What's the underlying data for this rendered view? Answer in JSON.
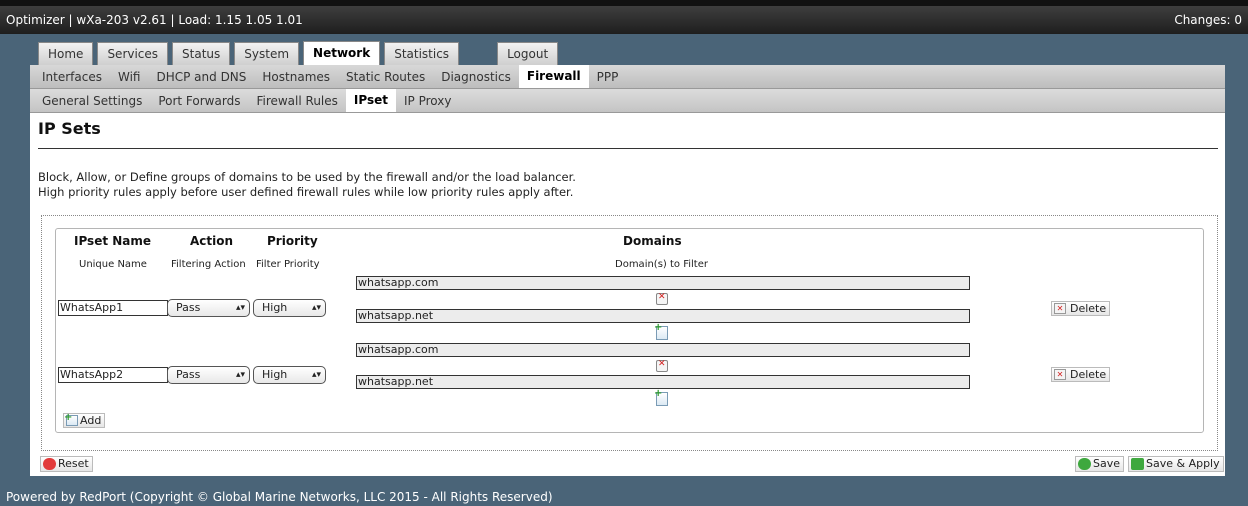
{
  "header": {
    "title": "Optimizer | wXa-203 v2.61 | Load: 1.15 1.05 1.01",
    "changes": "Changes: 0"
  },
  "main_tabs": [
    "Home",
    "Services",
    "Status",
    "System",
    "Network",
    "Statistics",
    "Logout"
  ],
  "network_menu": [
    "Interfaces",
    "Wifi",
    "DHCP and DNS",
    "Hostnames",
    "Static Routes",
    "Diagnostics",
    "Firewall",
    "PPP"
  ],
  "firewall_menu": [
    "General Settings",
    "Port Forwards",
    "Firewall Rules",
    "IPset",
    "IP Proxy"
  ],
  "page": {
    "title": "IP Sets",
    "description_line1": "Block, Allow, or Define groups of domains to be used by the firewall and/or the load balancer.",
    "description_line2": "High priority rules apply before user defined firewall rules while low priority rules apply after."
  },
  "table": {
    "headers": {
      "name": "IPset Name",
      "action": "Action",
      "priority": "Priority",
      "domains": "Domains"
    },
    "subheaders": {
      "name": "Unique Name",
      "action": "Filtering Action",
      "priority": "Filter Priority",
      "domains": "Domain(s) to Filter"
    },
    "rows": [
      {
        "name": "WhatsApp1",
        "action": "Pass",
        "priority": "High",
        "domains": [
          "whatsapp.com",
          "whatsapp.net"
        ],
        "delete_label": "Delete"
      },
      {
        "name": "WhatsApp2",
        "action": "Pass",
        "priority": "High",
        "domains": [
          "whatsapp.com",
          "whatsapp.net"
        ],
        "delete_label": "Delete"
      }
    ],
    "add_label": "Add"
  },
  "buttons": {
    "reset": "Reset",
    "save": "Save",
    "save_apply": "Save & Apply"
  },
  "footer": "Powered by RedPort (Copyright © Global Marine Networks, LLC 2015 - All Rights Reserved)",
  "colors": {
    "background": "#4a6478",
    "header": "#2a2a2a",
    "delete_icon": "#d42020",
    "save_icon": "#3ea83e",
    "reset_icon": "#e23b3b"
  }
}
